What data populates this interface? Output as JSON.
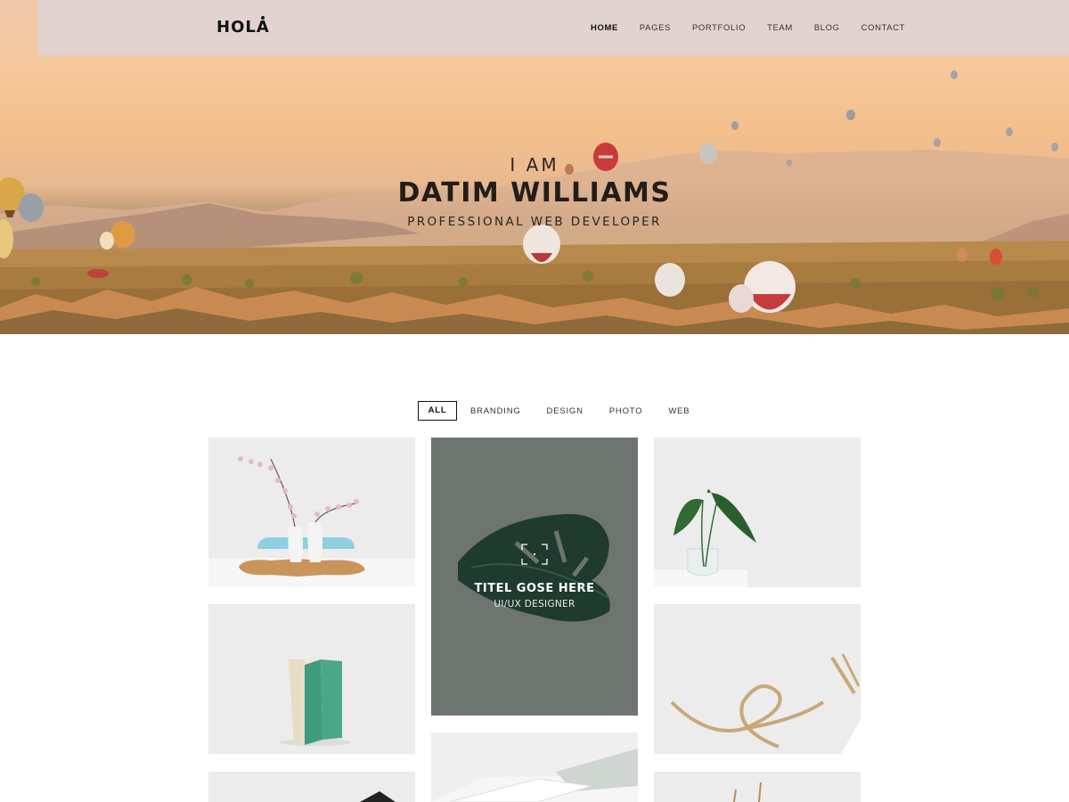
{
  "brand": {
    "logo": "HOLA"
  },
  "nav": {
    "items": [
      {
        "label": "HOME",
        "active": true
      },
      {
        "label": "PAGES",
        "active": false
      },
      {
        "label": "PORTFOLIO",
        "active": false
      },
      {
        "label": "TEAM",
        "active": false
      },
      {
        "label": "BLOG",
        "active": false
      },
      {
        "label": "CONTACT",
        "active": false
      }
    ]
  },
  "hero": {
    "intro": "I AM",
    "name": "DATIM WILLIAMS",
    "role": "PROFESSIONAL WEB DEVELOPER"
  },
  "portfolio": {
    "filters": [
      {
        "label": "ALL",
        "active": true
      },
      {
        "label": "BRANDING",
        "active": false
      },
      {
        "label": "DESIGN",
        "active": false
      },
      {
        "label": "PHOTO",
        "active": false
      },
      {
        "label": "WEB",
        "active": false
      }
    ],
    "featured": {
      "title": "TITEL GOSE HERE",
      "subtitle": "UI/UX DESIGNER",
      "icon": "focus-frame-icon"
    }
  },
  "colors": {
    "accent": "#111111",
    "featured_bg": "#6e7470",
    "card_bg": "#ececec"
  }
}
